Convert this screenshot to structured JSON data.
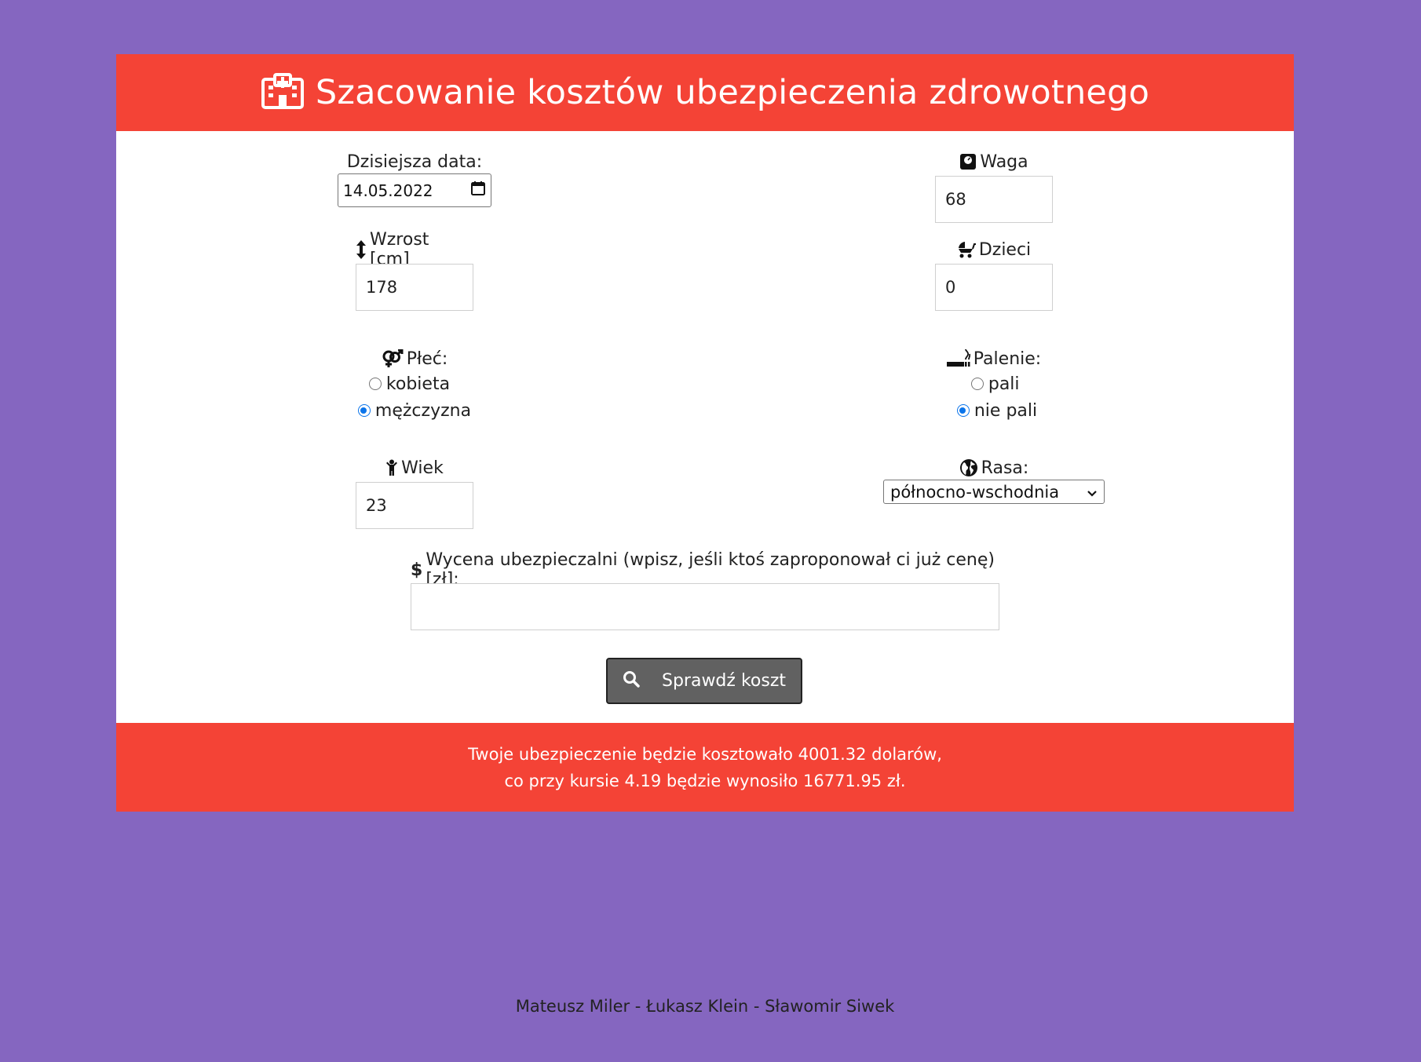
{
  "header": {
    "title": "Szacowanie kosztów ubezpieczenia zdrowotnego",
    "icon": "hospital-icon"
  },
  "form": {
    "date": {
      "label": "Dzisiejsza data:",
      "value": "14.05.2022",
      "icon": "calendar-icon"
    },
    "weight": {
      "label": "Waga",
      "value": "68",
      "icon": "scale-icon"
    },
    "height": {
      "label": "Wzrost [cm]",
      "value": "178",
      "icon": "arrows-vertical-icon"
    },
    "children": {
      "label": "Dzieci",
      "value": "0",
      "icon": "baby-carriage-icon"
    },
    "sex": {
      "label": "Płeć:",
      "icon": "venus-mars-icon",
      "options": [
        {
          "label": "kobieta",
          "checked": false
        },
        {
          "label": "mężczyzna",
          "checked": true
        }
      ]
    },
    "smoking": {
      "label": "Palenie:",
      "icon": "smoking-icon",
      "options": [
        {
          "label": "pali",
          "checked": false
        },
        {
          "label": "nie pali",
          "checked": true
        }
      ]
    },
    "age": {
      "label": "Wiek",
      "value": "23",
      "icon": "child-icon"
    },
    "region": {
      "label": "Rasa:",
      "selected": "północno-wschodnia",
      "icon": "globe-icon"
    },
    "quote": {
      "label": "Wycena ubezpieczalni (wpisz, jeśli ktoś zaproponował ci już cenę) [zł]:",
      "value": "",
      "icon": "dollar-icon"
    },
    "submit_label": "Sprawdź koszt"
  },
  "result": {
    "line1": "Twoje ubezpieczenie będzie kosztowało 4001.32 dolarów,",
    "line2": "co przy kursie 4.19 będzie wynosiło 16771.95 zł."
  },
  "footer": {
    "authors": "Mateusz Miler - Łukasz Klein - Sławomir Siwek"
  },
  "colors": {
    "background": "#8566c0",
    "accent": "#f44336",
    "button": "#616161",
    "radio_checked": "#0b74ea"
  }
}
